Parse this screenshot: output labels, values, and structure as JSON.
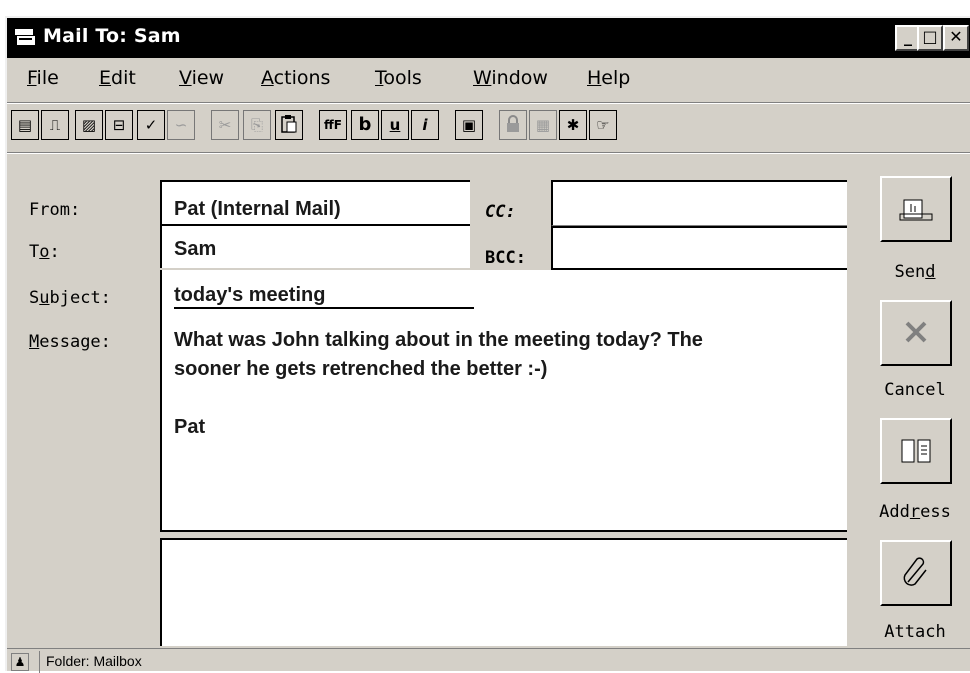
{
  "window": {
    "title": "Mail To: Sam",
    "minimize_label": "_",
    "maximize_label": "□",
    "close_label": "✕"
  },
  "menu": [
    {
      "pre": "",
      "key": "F",
      "post": "ile"
    },
    {
      "pre": "",
      "key": "E",
      "post": "dit"
    },
    {
      "pre": "",
      "key": "V",
      "post": "iew"
    },
    {
      "pre": "",
      "key": "A",
      "post": "ctions"
    },
    {
      "pre": "",
      "key": "T",
      "post": "ools"
    },
    {
      "pre": "",
      "key": "W",
      "post": "indow"
    },
    {
      "pre": "",
      "key": "H",
      "post": "elp"
    }
  ],
  "toolbar": {
    "tools": [
      {
        "icon": "document-list-icon",
        "glyph": "▤"
      },
      {
        "icon": "send-tray-icon",
        "glyph": "⎍"
      },
      {
        "icon": "properties-icon",
        "glyph": "▨"
      },
      {
        "icon": "save-icon",
        "glyph": "⊟"
      },
      {
        "icon": "spell-check-icon",
        "glyph": "✓"
      },
      {
        "icon": "signature-icon",
        "glyph": "∽"
      },
      {
        "icon": "cut-icon",
        "glyph": "✂"
      },
      {
        "icon": "copy-icon",
        "glyph": "⎘"
      },
      {
        "icon": "paste-icon",
        "glyph": "📋"
      },
      {
        "icon": "font-icon",
        "glyph": "ffF"
      },
      {
        "icon": "bold-icon",
        "glyph": "b"
      },
      {
        "icon": "underline-icon",
        "glyph": "u"
      },
      {
        "icon": "italic-icon",
        "glyph": "i"
      },
      {
        "icon": "address-book-icon",
        "glyph": "▣"
      },
      {
        "icon": "lock-icon",
        "glyph": "🔒"
      },
      {
        "icon": "certificate-icon",
        "glyph": "▦"
      },
      {
        "icon": "magic-wand-icon",
        "glyph": "✱"
      },
      {
        "icon": "help-pointer-icon",
        "glyph": "☞"
      }
    ]
  },
  "form": {
    "from_label": "From:",
    "from_value": "Pat (Internal Mail)",
    "cc_label": "CC:",
    "cc_value": "",
    "to_label": "To:",
    "to_value": "Sam",
    "bcc_label": "BCC:",
    "bcc_value": "",
    "subject_label": "Subject:",
    "subject_value": "today's meeting",
    "message_label": "Message:",
    "message_lines": [
      "What was John talking about in the meeting today? The",
      "sooner he gets retrenched the better  :-)",
      "",
      "Pat"
    ],
    "attachments_value": ""
  },
  "side_buttons": {
    "send": {
      "pre": "Sen",
      "key": "d",
      "post": ""
    },
    "cancel": {
      "pre": "Cancel",
      "key": "",
      "post": ""
    },
    "address": {
      "pre": "Add",
      "key": "r",
      "post": "ess"
    },
    "attach": {
      "pre": "Attach",
      "key": "",
      "post": ""
    }
  },
  "status": {
    "folder_text": "Folder: Mailbox"
  }
}
